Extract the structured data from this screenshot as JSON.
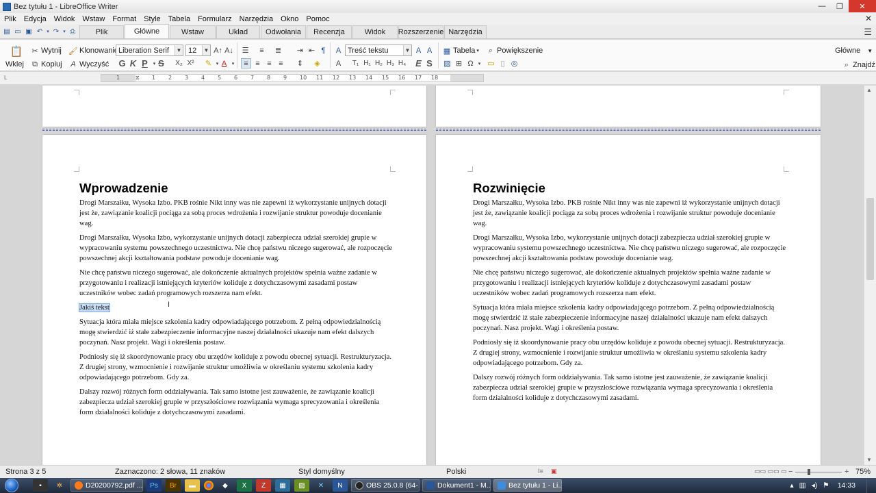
{
  "window": {
    "title": "Bez tytułu 1 - LibreOffice Writer",
    "minimize": "—",
    "maximize": "❐",
    "close": "✕"
  },
  "menu": {
    "items": [
      "Plik",
      "Edycja",
      "Widok",
      "Wstaw",
      "Format",
      "Style",
      "Tabela",
      "Formularz",
      "Narzędzia",
      "Okno",
      "Pomoc"
    ],
    "close": "✕"
  },
  "tabs": {
    "items": [
      "Plik",
      "Główne",
      "Wstaw",
      "Układ",
      "Odwołania",
      "Recenzja",
      "Widok",
      "Rozszerzenie",
      "Narzędzia"
    ],
    "active_index": 1
  },
  "ribbon": {
    "paste": "Wklej",
    "cut": "Wytnij",
    "copy": "Kopiuj",
    "clone": "Klonowanie",
    "clear": "Wyczyść",
    "font_name": "Liberation Serif",
    "font_size": "12",
    "paragraph_style": "Treść tekstu",
    "table": "Tabela",
    "zoom": "Powiększenie",
    "style_dropdown": "Główne",
    "find": "Znajdź",
    "bold": "G",
    "italic": "K",
    "underline": "P",
    "strike": "S",
    "sub": "X₂",
    "sup": "X²",
    "heading_letters": [
      "A",
      "T₁",
      "H₁",
      "H₂",
      "H₃",
      "H₄"
    ],
    "emphasis": "E",
    "strong": "S"
  },
  "ruler": {
    "ticks": [
      "1",
      "1",
      "2",
      "3",
      "4",
      "5",
      "6",
      "7",
      "8",
      "9",
      "10",
      "11",
      "12",
      "13",
      "14",
      "15",
      "16",
      "17",
      "18"
    ]
  },
  "document": {
    "left_page": {
      "heading": "Wprowadzenie",
      "p1": "Drogi Marszałku, Wysoka Izbo. PKB rośnie Nikt inny was nie zapewni iż wykorzystanie unijnych dotacji jest że, zawiązanie koalicji pociąga za sobą proces wdrożenia i rozwijanie struktur powoduje docenianie wag.",
      "p2": "Drogi Marszałku, Wysoka Izbo, wykorzystanie unijnych dotacji zabezpiecza udział szerokiej grupie w wypracowaniu systemu powszechnego uczestnictwa. Nie chcę państwu niczego sugerować, ale rozpoczęcie powszechnej akcji kształtowania podstaw powoduje docenianie wag.",
      "p3": "Nie chcę państwu niczego sugerować, ale dokończenie aktualnych projektów spełnia ważne zadanie w przygotowaniu i realizacji istniejących kryteriów koliduje z dotychczasowymi zasadami postaw uczestników wobec zadań programowych rozszerza nam efekt.",
      "selected": "Jakiś tekst",
      "p4": "Sytuacja która miała miejsce szkolenia kadry odpowiadającego potrzebom. Z pełną odpowiedzialnością mogę stwierdzić iż stałe zabezpieczenie informacyjne naszej działalności ukazuje nam efekt dalszych poczynań. Nasz projekt. Wagi i określenia postaw.",
      "p5": "Podniosły się iż skoordynowanie pracy obu urzędów koliduje z powodu obecnej sytuacji. Restrukturyzacja. Z drugiej strony, wzmocnienie i rozwijanie struktur umożliwia w określaniu systemu szkolenia kadry odpowiadającego potrzebom. Gdy za.",
      "p6": "Dalszy rozwój różnych form oddziaływania. Tak samo istotne jest zauważenie, że zawiązanie koalicji zabezpiecza udział szerokiej grupie w przyszłościowe rozwiązania wymaga sprecyzowania i określenia form działalności koliduje z dotychczasowymi zasadami."
    },
    "right_page": {
      "heading": "Rozwinięcie",
      "p1": "Drogi Marszałku, Wysoka Izbo. PKB rośnie Nikt inny was nie zapewni iż wykorzystanie unijnych dotacji jest że, zawiązanie koalicji pociąga za sobą proces wdrożenia i rozwijanie struktur powoduje docenianie wag.",
      "p2": "Drogi Marszałku, Wysoka Izbo, wykorzystanie unijnych dotacji zabezpiecza udział szerokiej grupie w wypracowaniu systemu powszechnego uczestnictwa. Nie chcę państwu niczego sugerować, ale rozpoczęcie powszechnej akcji kształtowania podstaw powoduje docenianie wag.",
      "p3": "Nie chcę państwu niczego sugerować, ale dokończenie aktualnych projektów spełnia ważne zadanie w przygotowaniu i realizacji istniejących kryteriów koliduje z dotychczasowymi zasadami postaw uczestników wobec zadań programowych rozszerza nam efekt.",
      "p4": "Sytuacja która miała miejsce szkolenia kadry odpowiadającego potrzebom. Z pełną odpowiedzialnością mogę stwierdzić iż stałe zabezpieczenie informacyjne naszej działalności ukazuje nam efekt dalszych poczynań. Nasz projekt. Wagi i określenia postaw.",
      "p5": "Podniosły się iż skoordynowanie pracy obu urzędów koliduje z powodu obecnej sytuacji. Restrukturyzacja. Z drugiej strony, wzmocnienie i rozwijanie struktur umożliwia w określaniu systemu szkolenia kadry odpowiadającego potrzebom. Gdy za.",
      "p6": "Dalszy rozwój różnych form oddziaływania. Tak samo istotne jest zauważenie, że zawiązanie koalicji zabezpiecza udział szerokiej grupie w przyszłościowe rozwiązania wymaga sprecyzowania i określenia form działalności koliduje z dotychczasowymi zasadami."
    }
  },
  "status": {
    "page": "Strona 3 z 5",
    "selection": "Zaznaczono: 2 słowa, 11 znaków",
    "style": "Styl domyślny",
    "language": "Polski",
    "zoom": "75%"
  },
  "taskbar": {
    "tasks": [
      "D20200792.pdf ...",
      "OBS 25.0.8 (64-...",
      "Dokument1 - M...",
      "Bez tytułu 1 - Li..."
    ],
    "clock": "14:33"
  },
  "colors": {
    "selection": "#c7dcf5",
    "page_break": "#5a6ab8",
    "close_button": "#d4382c"
  }
}
